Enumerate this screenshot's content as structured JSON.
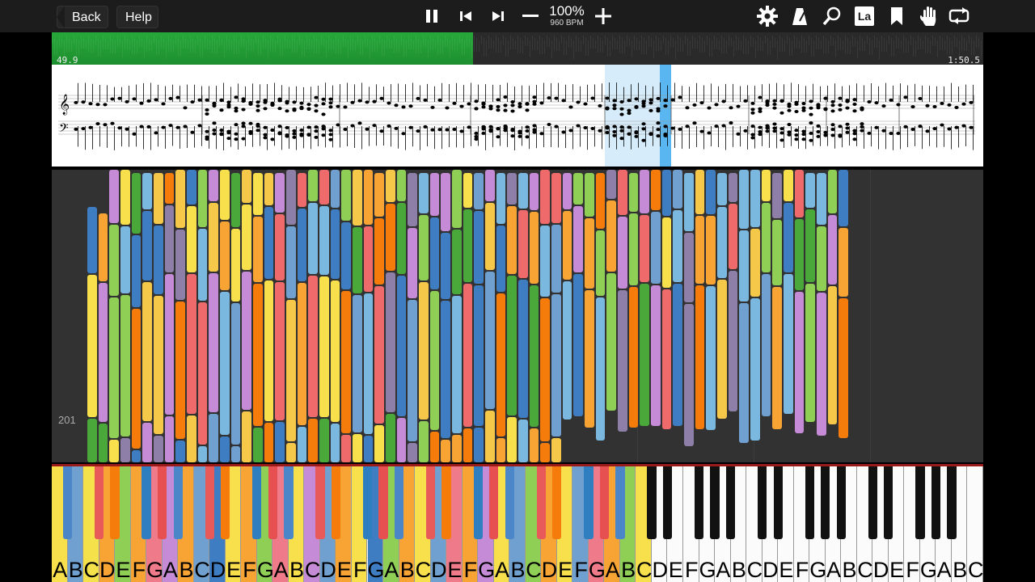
{
  "toolbar": {
    "back_label": "Back",
    "help_label": "Help",
    "tempo_percent": "100%",
    "tempo_bpm": "960 BPM",
    "icons": [
      "pause-icon",
      "skip-back-icon",
      "skip-forward-icon",
      "minus-icon",
      "plus-icon",
      "gear-icon",
      "metronome-icon",
      "search-icon",
      "label-icon",
      "bookmark-icon",
      "hand-icon",
      "loop-icon"
    ],
    "label_icon_text": "La"
  },
  "progress": {
    "elapsed": "49.9",
    "total": "1:50.5",
    "fraction": 0.4525,
    "color": "#27a83a"
  },
  "roll": {
    "measure_number": "201"
  },
  "keyboard": {
    "labels": "ABCDEFGABCDEFGABCDEFGABCDEFGABCDEFGABCDEFGABCDEFGABCDEFGABC",
    "pressed_colors": [
      "#f7e04b",
      "#6fa0cf",
      "#f5e24a",
      "#f7a435",
      "#8fcf56",
      "#f7a435",
      "#ef7a8a",
      "#c58bd6",
      "#f7a435",
      "#6fa0cf",
      "#3f7dc2",
      "#f7e04b",
      "#f7a435",
      "#8fcf56",
      "#ef7a8a",
      "#f7e04b",
      "#c58bd6",
      "#6fa0cf",
      "#f7a435",
      "#f7e04b",
      "#3f7dc2",
      "#8fcf56",
      "#f7a435",
      "#f7e04b",
      "#6fa0cf",
      "#ef7a8a",
      "#f7a435",
      "#c58bd6",
      "#f7e04b",
      "#6fa0cf",
      "#8fcf56",
      "#f7a435",
      "#f7e04b",
      "#6fa0cf",
      "#ef7a8a",
      "#f7a435",
      "#8fcf56",
      "#f7e04b"
    ]
  },
  "palette": [
    "#f7e04b",
    "#f7a435",
    "#f57c0a",
    "#6fa0cf",
    "#3f7dc2",
    "#8fcf56",
    "#4aa83a",
    "#ef6b6b",
    "#c58bd6",
    "#8d7fa8",
    "#f5c84a",
    "#7ab8e0"
  ]
}
